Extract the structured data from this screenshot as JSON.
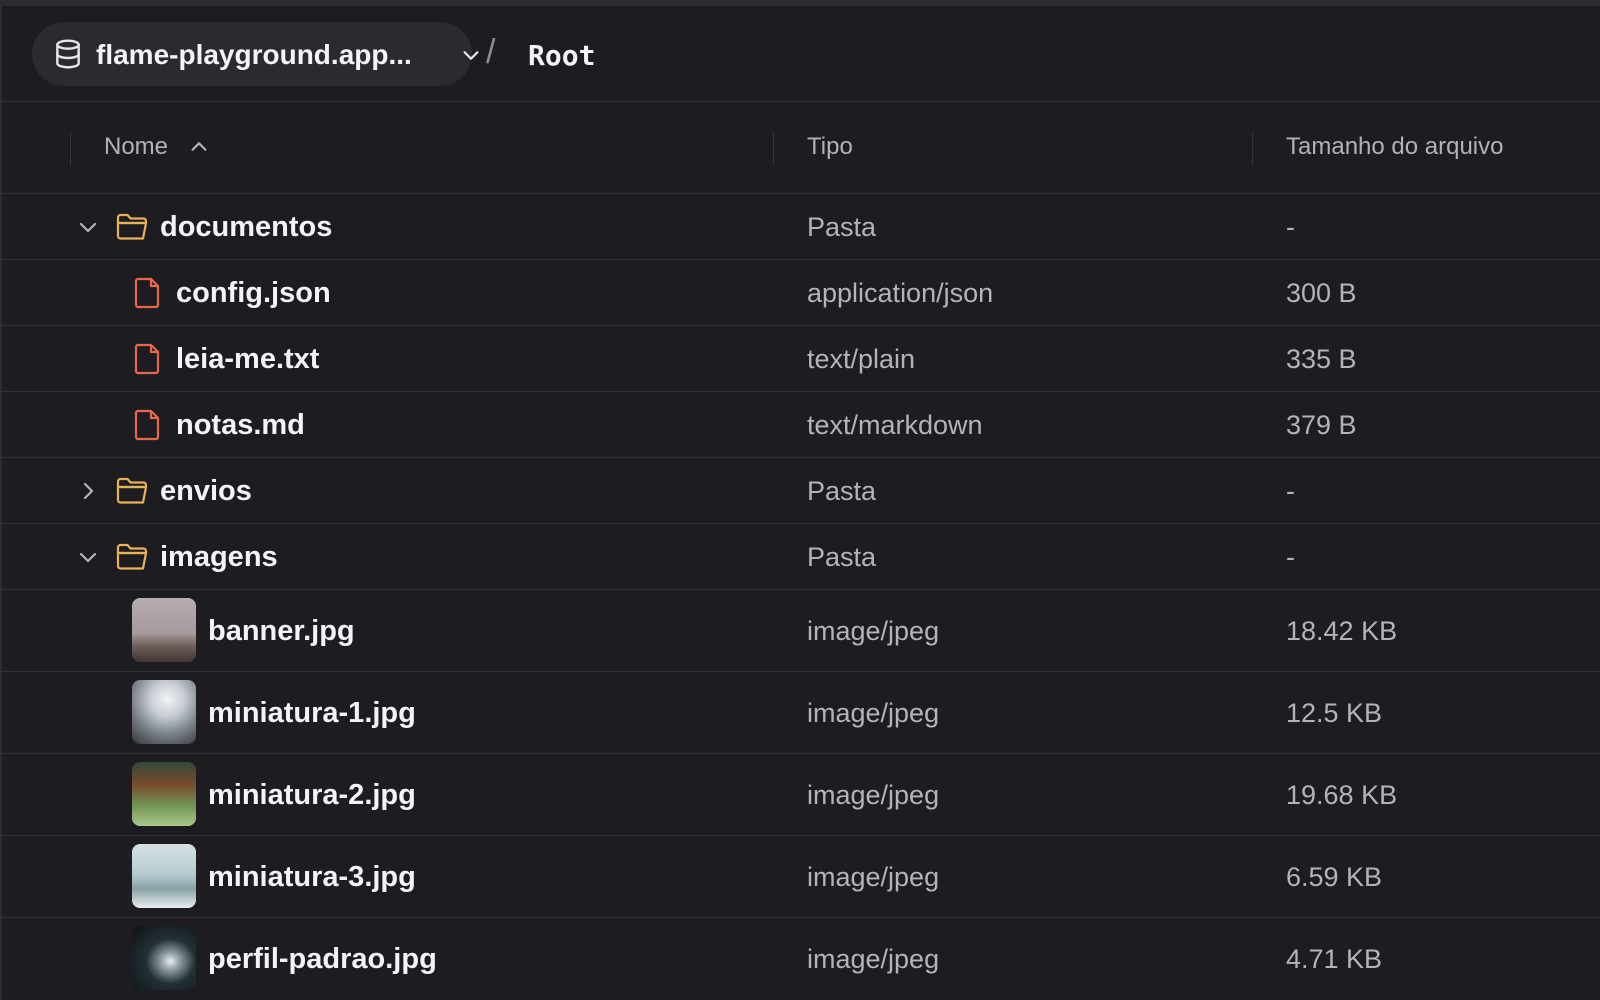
{
  "breadcrumb": {
    "bucket_name": "flame-playground.app...",
    "separator": "/",
    "current": "Root"
  },
  "columns": {
    "name": "Nome",
    "type": "Tipo",
    "size": "Tamanho do arquivo"
  },
  "rows": [
    {
      "name": "documentos",
      "type": "Pasta",
      "size": "-"
    },
    {
      "name": "config.json",
      "type": "application/json",
      "size": "300 B"
    },
    {
      "name": "leia-me.txt",
      "type": "text/plain",
      "size": "335 B"
    },
    {
      "name": "notas.md",
      "type": "text/markdown",
      "size": "379 B"
    },
    {
      "name": "envios",
      "type": "Pasta",
      "size": "-"
    },
    {
      "name": "imagens",
      "type": "Pasta",
      "size": "-"
    },
    {
      "name": "banner.jpg",
      "type": "image/jpeg",
      "size": "18.42 KB"
    },
    {
      "name": "miniatura-1.jpg",
      "type": "image/jpeg",
      "size": "12.5 KB"
    },
    {
      "name": "miniatura-2.jpg",
      "type": "image/jpeg",
      "size": "19.68 KB"
    },
    {
      "name": "miniatura-3.jpg",
      "type": "image/jpeg",
      "size": "6.59 KB"
    },
    {
      "name": "perfil-padrao.jpg",
      "type": "image/jpeg",
      "size": "4.71 KB"
    }
  ],
  "icons": {
    "bucket": "database-icon",
    "bucket_menu": "chevron-down-icon",
    "sort": "sort-ascending-icon",
    "expanded": "chevron-down-icon",
    "collapsed": "chevron-right-icon",
    "folder": "folder-icon",
    "file": "file-icon"
  },
  "colors": {
    "background": "#1c1c21",
    "folder": "#e8b15a",
    "file": "#e8674a",
    "text_primary": "#f4f4f7",
    "text_secondary": "#b3b3bc"
  }
}
